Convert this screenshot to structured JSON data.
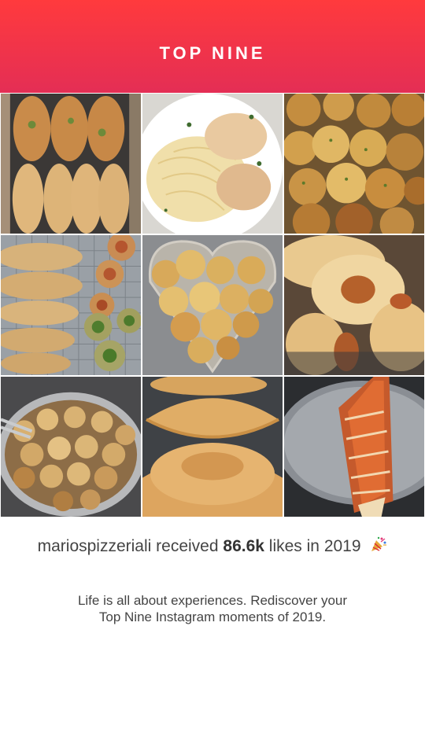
{
  "header": {
    "title": "TOP NINE"
  },
  "grid": {
    "posts": [
      {
        "name": "post-calzone-trays"
      },
      {
        "name": "post-fettuccine-alfredo"
      },
      {
        "name": "post-garlic-knots"
      },
      {
        "name": "post-stromboli-pinwheels"
      },
      {
        "name": "post-heart-tray-garlic-knots"
      },
      {
        "name": "post-cheesy-knot-rolls"
      },
      {
        "name": "post-garlic-knot-bowl"
      },
      {
        "name": "post-stacked-calzones"
      },
      {
        "name": "post-sauced-stromboli"
      }
    ]
  },
  "summary": {
    "username": "mariospizzeriali",
    "received_text": "received",
    "likes": "86.6k",
    "likes_suffix": "likes in 2019",
    "emoji_icon": "party-popper-icon"
  },
  "tagline": {
    "line1": "Life is all about experiences. Rediscover your",
    "line2": "Top Nine Instagram moments of 2019."
  },
  "colors": {
    "header_top": "#ff3a3d",
    "header_bottom": "#e42e55"
  }
}
